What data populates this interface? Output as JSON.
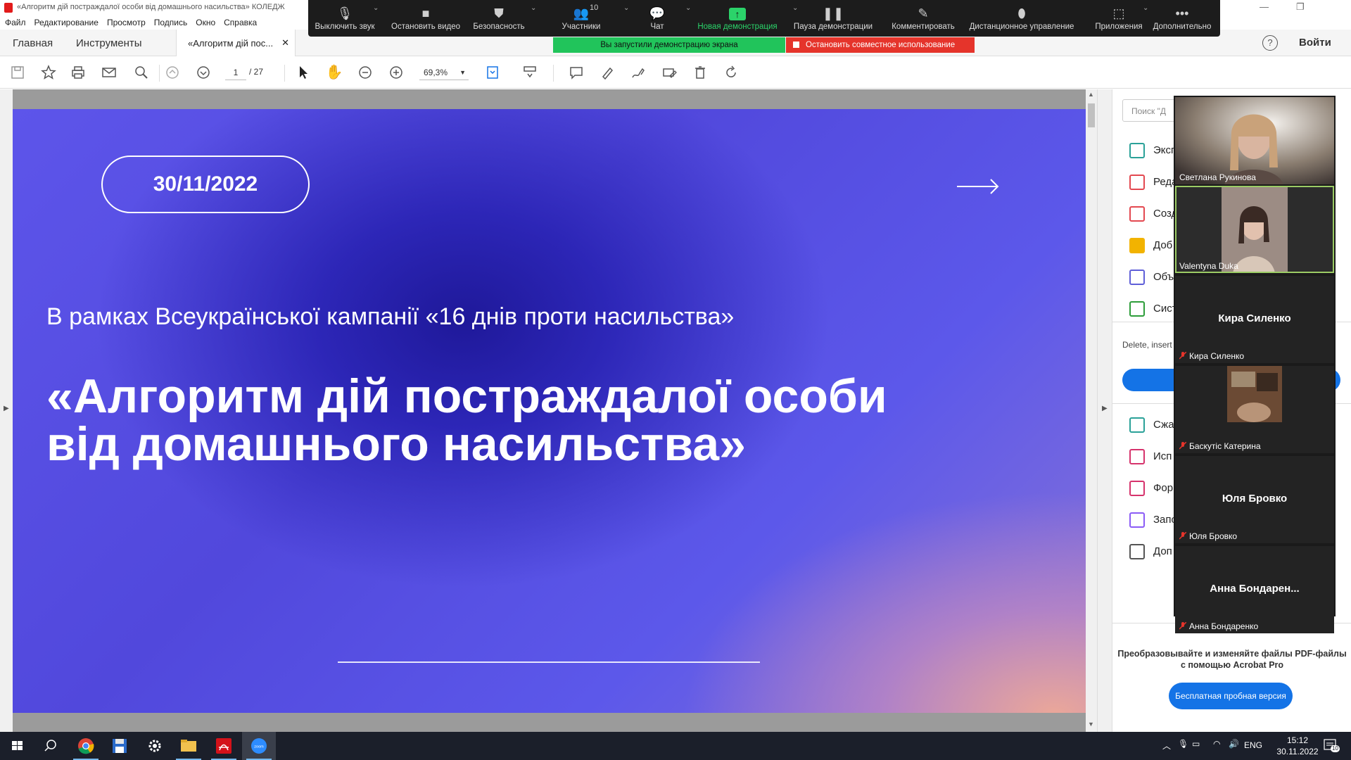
{
  "acrobat": {
    "window_title": "«Алгоритм дій постраждалої особи від домашнього насильства» КОЛЕДЖ",
    "menu": [
      "Файл",
      "Редактирование",
      "Просмотр",
      "Подпись",
      "Окно",
      "Справка"
    ],
    "tabs": {
      "home": "Главная",
      "tools": "Инструменты",
      "doc": "«Алгоритм дій пос..."
    },
    "help_glyph": "?",
    "login": "Войти",
    "page": {
      "current": "1",
      "total": "/ 27"
    },
    "zoom": "69,3%"
  },
  "slide": {
    "date": "30/11/2022",
    "subtitle": "В рамках Всеукраїнської кампанії «16 днів проти насильства»",
    "title_line1": "«Алгоритм дій постраждалої особи",
    "title_line2": "від домашнього насильства»"
  },
  "right_panel": {
    "search_placeholder": "Поиск \"Д",
    "tools": [
      {
        "label": "Эксп",
        "icon": "export-pdf-icon",
        "color": "#2aa198"
      },
      {
        "label": "Реда",
        "icon": "edit-pdf-icon",
        "color": "#e34850"
      },
      {
        "label": "Созд",
        "icon": "create-pdf-icon",
        "color": "#e34850"
      },
      {
        "label": "Доб",
        "icon": "comment-icon",
        "color": "#f2b300"
      },
      {
        "label": "Объ",
        "icon": "combine-files-icon",
        "color": "#5f5fd8"
      },
      {
        "label": "Сист",
        "icon": "organize-pages-icon",
        "color": "#2d9d3a"
      }
    ],
    "delete_text": "Delete, insert",
    "tools2": [
      {
        "label": "Сжа",
        "icon": "compress-pdf-icon",
        "color": "#2aa198"
      },
      {
        "label": "Исп",
        "icon": "fill-sign-icon",
        "color": "#d6336c"
      },
      {
        "label": "Фор",
        "icon": "prepare-form-icon",
        "color": "#d6336c"
      },
      {
        "label": "Запо",
        "icon": "request-signature-icon",
        "color": "#8b5cf6"
      },
      {
        "label": "Доп",
        "icon": "more-tools-icon",
        "color": "#555555"
      }
    ],
    "promo_line1": "Преобразовывайте и изменяйте файлы PDF-файлы",
    "promo_line2": "с помощью Acrobat Pro",
    "trial_button": "Бесплатная пробная версия"
  },
  "zoom_toolbar": {
    "items": [
      {
        "label": "Выключить звук",
        "icon": "microphone-icon"
      },
      {
        "label": "Остановить видео",
        "icon": "video-camera-icon"
      },
      {
        "label": "Безопасность",
        "icon": "shield-icon"
      },
      {
        "label": "Участники",
        "icon": "participants-icon",
        "count": "10"
      },
      {
        "label": "Чат",
        "icon": "chat-icon"
      },
      {
        "label": "Новая демонстрация",
        "icon": "share-screen-icon"
      },
      {
        "label": "Пауза демонстрации",
        "icon": "pause-icon"
      },
      {
        "label": "Комментировать",
        "icon": "pencil-icon"
      },
      {
        "label": "Дистанционное управление",
        "icon": "mouse-icon"
      },
      {
        "label": "Приложения",
        "icon": "apps-icon"
      },
      {
        "label": "Дополнительно",
        "icon": "more-icon"
      }
    ],
    "banner_sharing": "Вы запустили демонстрацию экрана",
    "banner_stop": "Остановить совместное использование"
  },
  "participants": [
    {
      "name": "Светлана Рукинова",
      "video": true,
      "muted": false
    },
    {
      "name": "Valentyna Duka",
      "video": true,
      "muted": false,
      "active": true
    },
    {
      "name": "Кира Силенко",
      "big_name": "Кира Силенко",
      "video": false,
      "muted": true
    },
    {
      "name": "Баскутіс Катерина",
      "video": true,
      "muted": true
    },
    {
      "name": "Юля Бровко",
      "big_name": "Юля Бровко",
      "video": false,
      "muted": true
    },
    {
      "name": "Анна Бондаренко",
      "big_name": "Анна  Бондарен...",
      "video": false,
      "muted": true
    }
  ],
  "taskbar": {
    "lang": "ENG",
    "time": "15:12",
    "date": "30.11.2022",
    "notifications": "10",
    "zoom_app_label": "zoom"
  }
}
